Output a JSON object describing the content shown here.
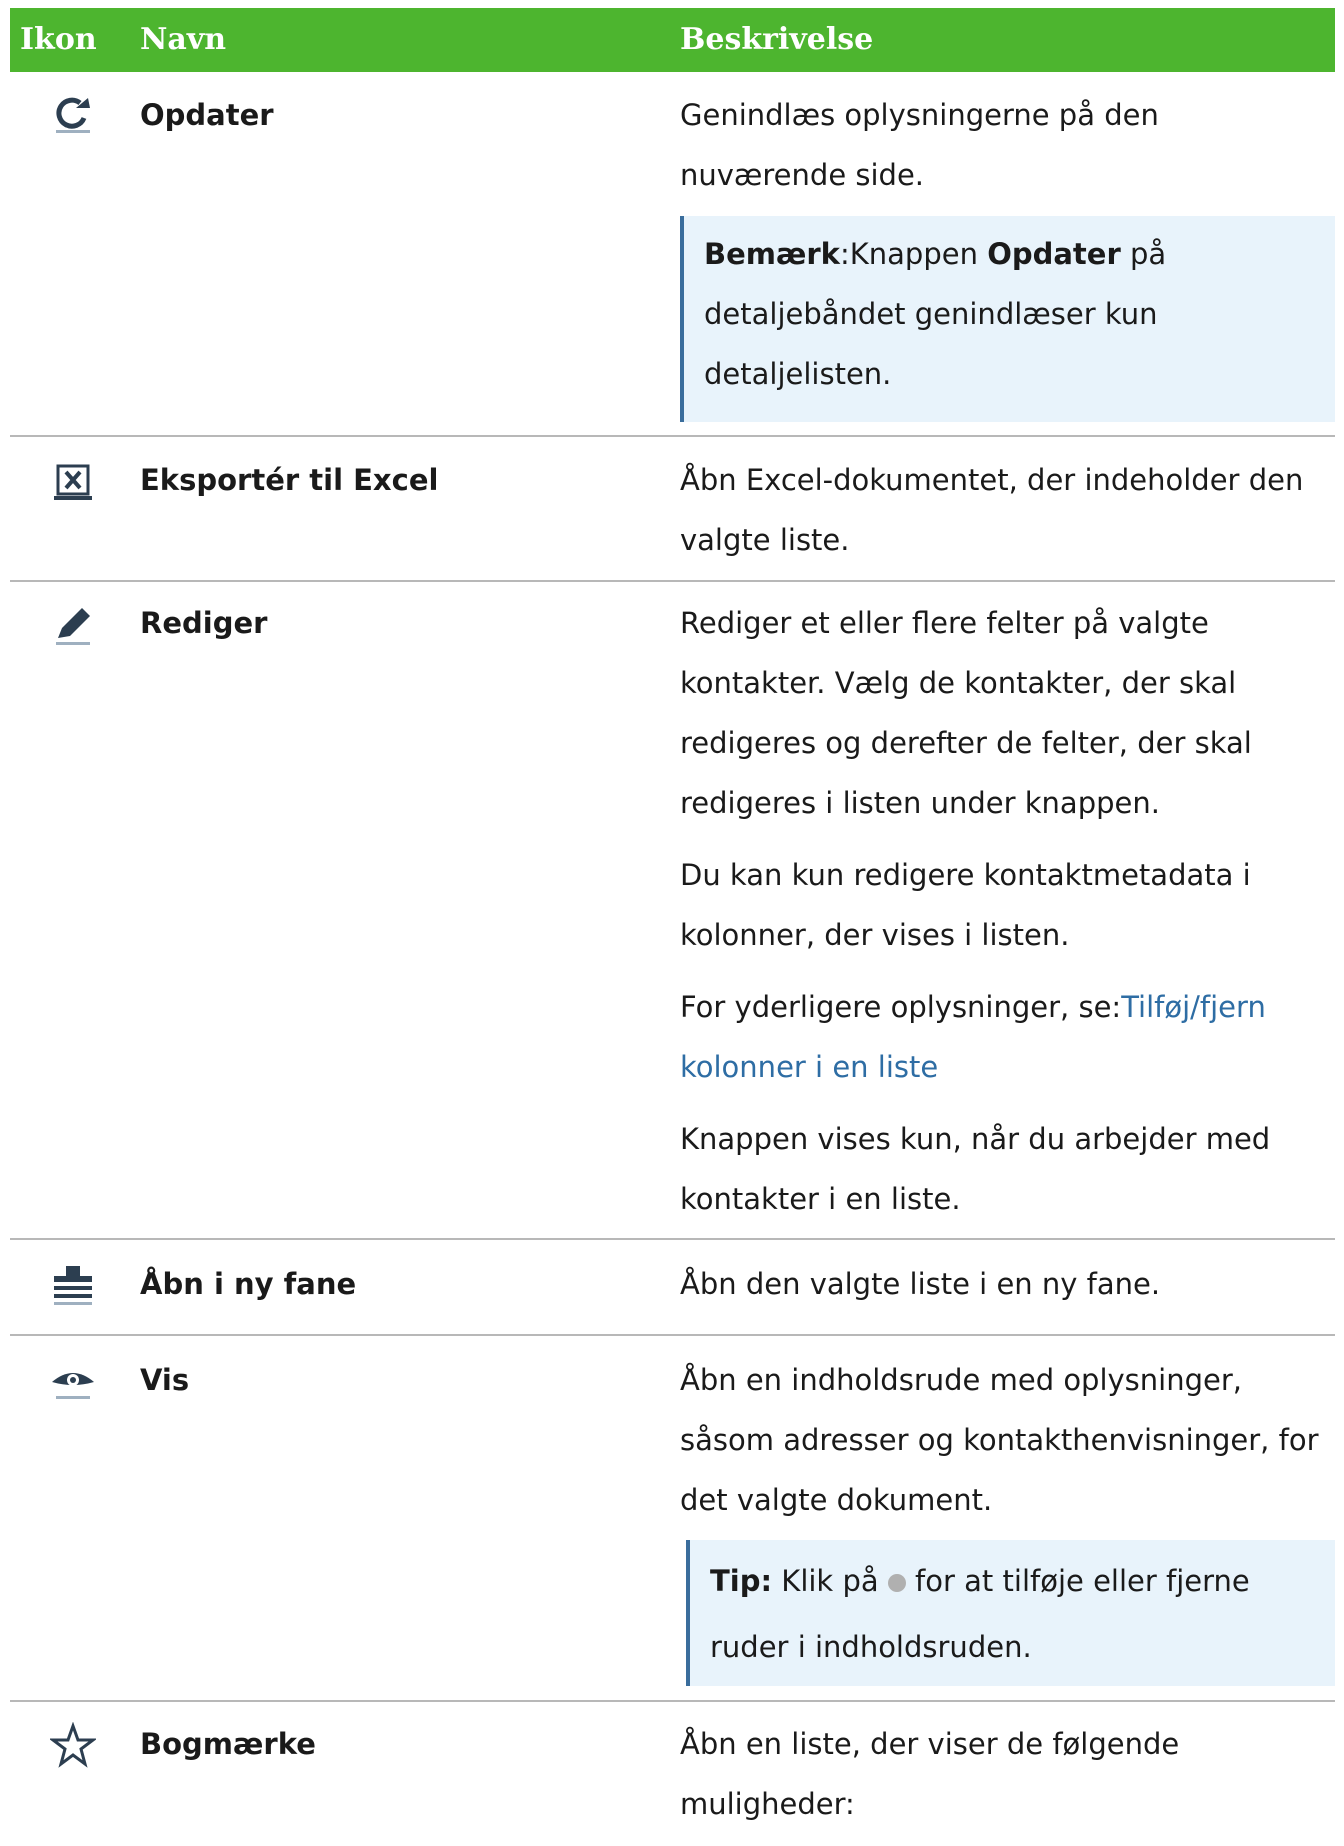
{
  "header": {
    "col_icon": "Ikon",
    "col_name": "Navn",
    "col_desc": "Beskrivelse"
  },
  "rows": [
    {
      "icon": "refresh-icon",
      "name": "Opdater",
      "desc": [
        "Genindlæs oplysningerne på den nuværende side."
      ],
      "note": {
        "label": "Bemærk",
        "sep": ":",
        "pre": "Knappen ",
        "bold": "Opdater",
        "post": " på detaljebåndet genindlæser kun detaljelisten."
      }
    },
    {
      "icon": "excel-export-icon",
      "name": "Eksportér til Excel",
      "desc": [
        "Åbn Excel-dokumentet, der indeholder den valgte liste."
      ]
    },
    {
      "icon": "pencil-icon",
      "name": "Rediger",
      "desc": [
        "Rediger et eller flere felter på valgte kontakter. Vælg de kontakter, der skal redigeres og derefter de felter, der skal redigeres i listen under knappen.",
        "Du kan kun redigere kontaktmetadata i kolonner, der vises i listen."
      ],
      "desc_link": {
        "pre": "For yderligere oplysninger, se:",
        "link": "Tilføj/fjern kolonner i en liste"
      },
      "desc_after": "Knappen vises kun, når du arbejder med kontakter i en liste."
    },
    {
      "icon": "new-tab-icon",
      "name": "Åbn i ny fane",
      "desc": [
        "Åbn den valgte liste i en ny fane."
      ]
    },
    {
      "icon": "eye-icon",
      "name": "Vis",
      "desc": [
        "Åbn en indholdsrude med oplysninger, såsom adresser og kontakthenvisninger, for det valgte dokument."
      ],
      "tip": {
        "label": "Tip:",
        "pre": " Klik på ",
        "post": " for at tilføje eller fjerne ruder i indholdsruden."
      }
    },
    {
      "icon": "star-icon",
      "name": "Bogmærke",
      "desc": [
        "Åbn en liste, der viser de følgende muligheder:"
      ]
    }
  ]
}
